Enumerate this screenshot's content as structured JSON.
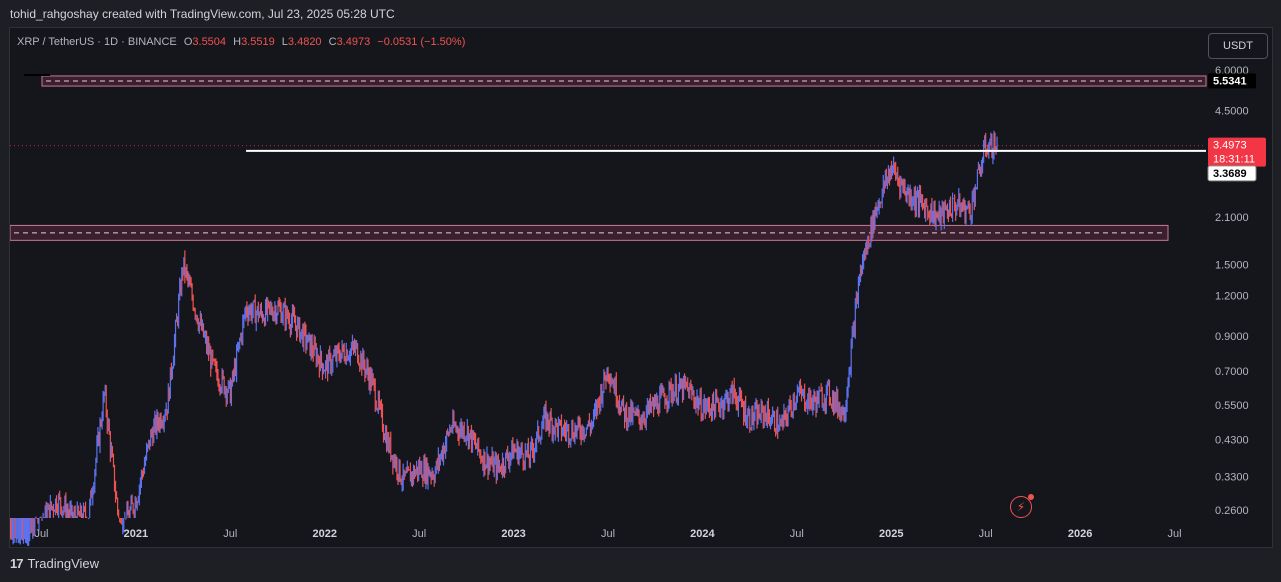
{
  "header": {
    "caption": "tohid_rahgoshay created with TradingView.com, Jul 23, 2025 05:28 UTC"
  },
  "legend": {
    "symbol": "XRP / TetherUS · 1D · BINANCE",
    "open_label": "O",
    "open": "3.5504",
    "high_label": "H",
    "high": "3.5519",
    "low_label": "L",
    "low": "3.4820",
    "close_label": "C",
    "close": "3.4973",
    "change": "−0.0531 (−1.50%)"
  },
  "toolbar": {
    "currency_label": "USDT"
  },
  "footer": {
    "brand": "TradingView",
    "logo_glyph": "17"
  },
  "colors": {
    "up": "#5b73f0",
    "down": "#ef5350",
    "zone_fill": "#5a2a3f",
    "zone_border": "#c67a94",
    "price_tag": "#f23645",
    "background": "#15161c"
  },
  "icons": {
    "alert": "lightning-alert-icon"
  },
  "chart_data": {
    "type": "candlestick",
    "scale": "log",
    "x_labels": [
      "Jul",
      "2021",
      "Jul",
      "2022",
      "Jul",
      "2023",
      "Jul",
      "2024",
      "Jul",
      "2025",
      "Jul",
      "2026",
      "Jul"
    ],
    "y_ticks": [
      "6.0000",
      "4.5000",
      "2.1000",
      "1.5000",
      "1.2000",
      "0.9000",
      "0.7000",
      "0.5500",
      "0.4300",
      "0.3300",
      "0.2600"
    ],
    "price_tags": {
      "top_zone": "5.5341",
      "last_price": "3.4973",
      "countdown": "18:31:11",
      "horizontal_line": "3.3689"
    },
    "zones": [
      {
        "low": 5.35,
        "high": 5.75
      },
      {
        "low": 1.78,
        "high": 1.98
      }
    ],
    "horizontal_line": {
      "value": 3.3689,
      "from": "2021-08",
      "to": "2026-07"
    },
    "price_path_monthly": [
      [
        "2020-05",
        0.205
      ],
      [
        "2020-06",
        0.185
      ],
      [
        "2020-07",
        0.24
      ],
      [
        "2020-08",
        0.28
      ],
      [
        "2020-09",
        0.245
      ],
      [
        "2020-10",
        0.25
      ],
      [
        "2020-11",
        0.6
      ],
      [
        "2020-12",
        0.22
      ],
      [
        "2021-01",
        0.28
      ],
      [
        "2021-02",
        0.45
      ],
      [
        "2021-03",
        0.55
      ],
      [
        "2021-04",
        1.5
      ],
      [
        "2021-05",
        1.0
      ],
      [
        "2021-06",
        0.7
      ],
      [
        "2021-07",
        0.6
      ],
      [
        "2021-08",
        1.1
      ],
      [
        "2021-09",
        1.05
      ],
      [
        "2021-10",
        1.1
      ],
      [
        "2021-11",
        1.0
      ],
      [
        "2021-12",
        0.85
      ],
      [
        "2022-01",
        0.72
      ],
      [
        "2022-02",
        0.8
      ],
      [
        "2022-03",
        0.82
      ],
      [
        "2022-04",
        0.65
      ],
      [
        "2022-05",
        0.42
      ],
      [
        "2022-06",
        0.32
      ],
      [
        "2022-07",
        0.35
      ],
      [
        "2022-08",
        0.34
      ],
      [
        "2022-09",
        0.47
      ],
      [
        "2022-10",
        0.46
      ],
      [
        "2022-11",
        0.38
      ],
      [
        "2022-12",
        0.35
      ],
      [
        "2023-01",
        0.4
      ],
      [
        "2023-02",
        0.38
      ],
      [
        "2023-03",
        0.5
      ],
      [
        "2023-04",
        0.46
      ],
      [
        "2023-05",
        0.46
      ],
      [
        "2023-06",
        0.48
      ],
      [
        "2023-07",
        0.72
      ],
      [
        "2023-08",
        0.52
      ],
      [
        "2023-09",
        0.5
      ],
      [
        "2023-10",
        0.55
      ],
      [
        "2023-11",
        0.61
      ],
      [
        "2023-12",
        0.62
      ],
      [
        "2024-01",
        0.54
      ],
      [
        "2024-02",
        0.55
      ],
      [
        "2024-03",
        0.6
      ],
      [
        "2024-04",
        0.5
      ],
      [
        "2024-05",
        0.52
      ],
      [
        "2024-06",
        0.47
      ],
      [
        "2024-07",
        0.6
      ],
      [
        "2024-08",
        0.56
      ],
      [
        "2024-09",
        0.6
      ],
      [
        "2024-10",
        0.52
      ],
      [
        "2024-11",
        1.4
      ],
      [
        "2024-12",
        2.2
      ],
      [
        "2025-01",
        3.0
      ],
      [
        "2025-02",
        2.5
      ],
      [
        "2025-03",
        2.3
      ],
      [
        "2025-04",
        2.1
      ],
      [
        "2025-05",
        2.3
      ],
      [
        "2025-06",
        2.2
      ],
      [
        "2025-07",
        3.5
      ]
    ]
  }
}
